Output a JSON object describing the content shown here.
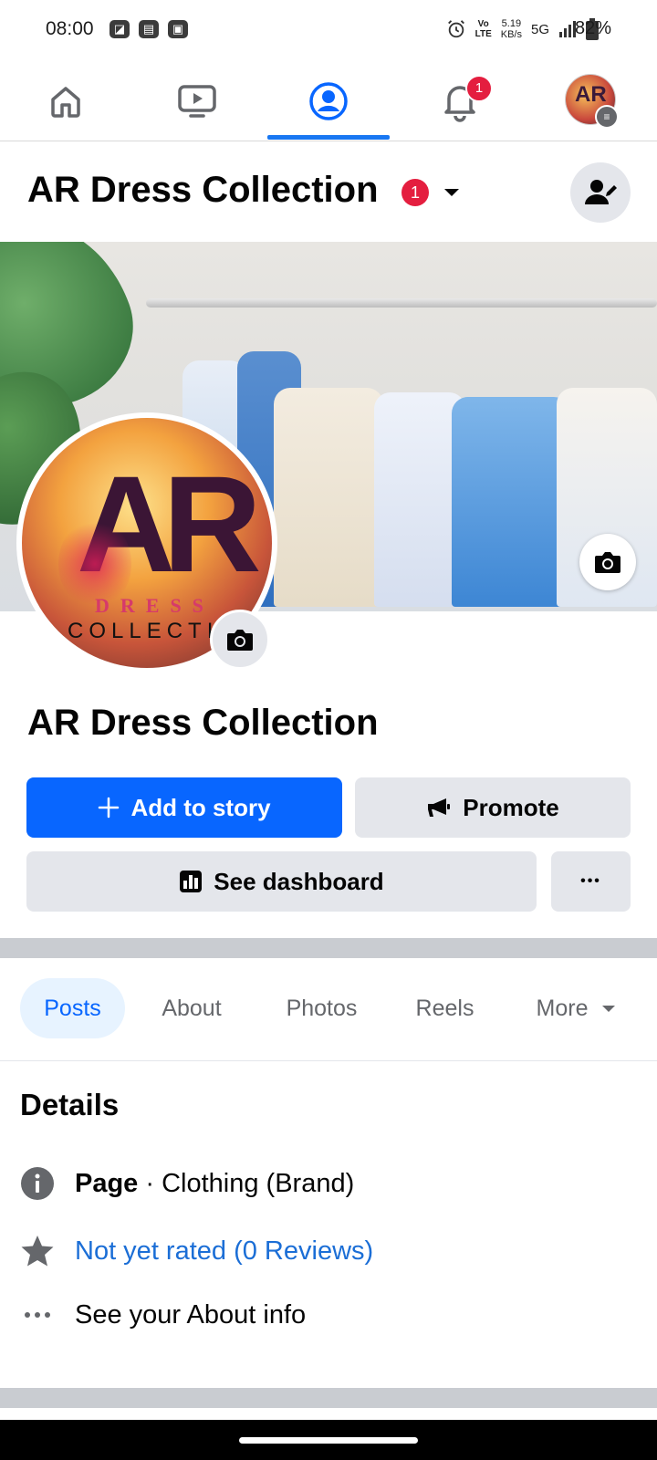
{
  "status_bar": {
    "time": "08:00",
    "network_speed": "5.19",
    "network_speed_unit": "KB/s",
    "network_type": "5G",
    "volte_top": "Vo",
    "volte_bottom": "LTE",
    "battery": "82%"
  },
  "nav": {
    "tabs": [
      "home-icon",
      "video-icon",
      "profile-icon",
      "notifications-icon",
      "menu-avatar"
    ],
    "active": "profile-icon",
    "notification_count": "1"
  },
  "header": {
    "title": "AR Dress Collection",
    "badge_count": "1"
  },
  "profile": {
    "logo_big": "AR",
    "logo_line1": "DRESS",
    "logo_line2": "COLLECTI"
  },
  "page": {
    "name": "AR Dress Collection"
  },
  "actions": {
    "add_story": "Add to story",
    "promote": "Promote",
    "dashboard": "See dashboard",
    "more": "•••"
  },
  "tabs": {
    "items": [
      "Posts",
      "About",
      "Photos",
      "Reels",
      "More"
    ],
    "active": "Posts"
  },
  "details": {
    "title": "Details",
    "category_label": "Page",
    "category_value": " · Clothing (Brand)",
    "rating": "Not yet rated (0 Reviews)",
    "about": "See your About info"
  },
  "colors": {
    "accent": "#0866ff",
    "badge": "#e41e3f",
    "button_gray": "#e4e6eb",
    "link_blue": "#1b6ed6"
  }
}
